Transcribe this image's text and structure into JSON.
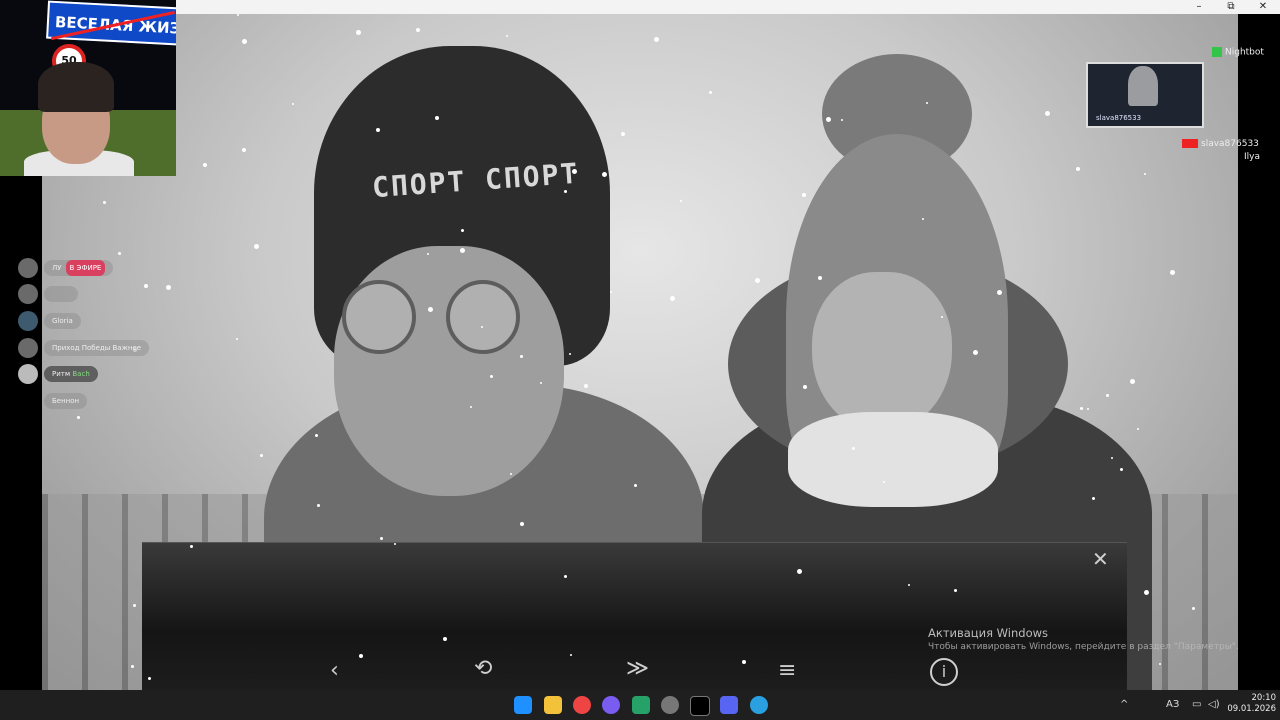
{
  "window": {
    "minimize": "–",
    "maximize": "⧉",
    "close": "✕"
  },
  "webcam": {
    "sign_text": "ВЕСЕЛАЯ ЖИЗ",
    "speed_limit": "50"
  },
  "game": {
    "hat_text": "СПОРТ СПОРТ",
    "dialog": {
      "close": "✕",
      "back": "‹",
      "auto": "⟲",
      "skip": "≫",
      "menu": "≡",
      "info": "i"
    },
    "activation_title": "Активация Windows",
    "activation_sub": "Чтобы активировать Windows, перейдите в раздел \"Параметры\"."
  },
  "chat": [
    {
      "text": "ЛУ",
      "badge": "В ЭФИРЕ",
      "icon": "avatar"
    },
    {
      "text": "",
      "badge": "",
      "icon": "avatar"
    },
    {
      "text": "Gloria",
      "badge": "",
      "icon": "avatar"
    },
    {
      "text": "Приход Победы Важнее",
      "badge": "",
      "icon": "avatar"
    },
    {
      "text": "Ритм",
      "extra": "Bach",
      "badge": "",
      "icon": "avatar"
    },
    {
      "text": "Беннон",
      "badge": "",
      "icon": "avatar"
    }
  ],
  "overlay": {
    "top_right_label": "Nightbot",
    "mini_cam_name": "slava876533",
    "bottom_right_label": "slava876533",
    "side_text": "Ilya"
  },
  "taskbar": {
    "tray_lang": "АЗ",
    "clock_time": "20:10",
    "clock_date": "09.01.2026"
  }
}
